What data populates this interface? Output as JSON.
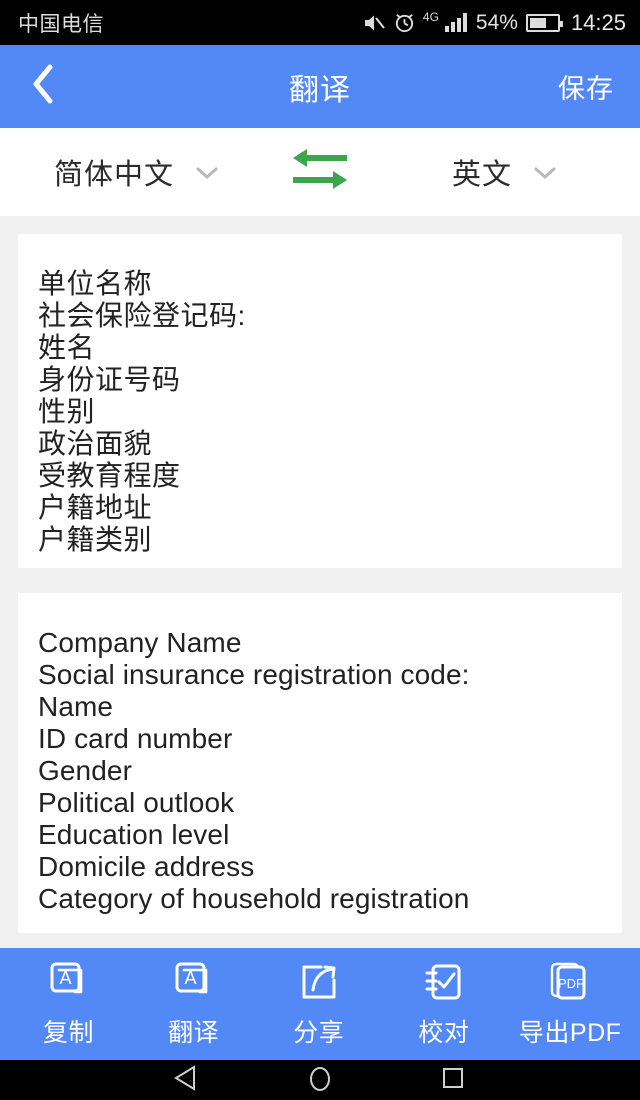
{
  "status_bar": {
    "carrier": "中国电信",
    "mute_icon": "mute-icon",
    "alarm_icon": "alarm-icon",
    "network_type": "4G",
    "signal_icon": "signal-bars-icon",
    "battery_percent": "54%",
    "battery_icon": "battery-icon",
    "time": "14:25"
  },
  "app_bar": {
    "back_icon": "back-chevron-icon",
    "title": "翻译",
    "save_label": "保存",
    "background_color": "#5289f7"
  },
  "language_bar": {
    "source_language": "简体中文",
    "target_language": "英文",
    "source_chevron_icon": "chevron-down-icon",
    "target_chevron_icon": "chevron-down-icon",
    "swap_icon": "swap-arrows-icon",
    "swap_color": "#3ba54b"
  },
  "source_text": {
    "lines": [
      "单位名称",
      "社会保险登记码:",
      "姓名",
      "身份证号码",
      "性别",
      "政治面貌",
      "受教育程度",
      "户籍地址",
      "户籍类别"
    ]
  },
  "target_text": {
    "lines": [
      "Company Name",
      "Social insurance registration code:",
      "Name",
      "ID card number",
      "Gender",
      "Political outlook",
      "Education level",
      "Domicile address",
      "Category of household registration"
    ]
  },
  "toolbar": {
    "items": [
      {
        "label": "复制",
        "icon": "copy-text-icon"
      },
      {
        "label": "翻译",
        "icon": "translate-text-icon"
      },
      {
        "label": "分享",
        "icon": "share-icon"
      },
      {
        "label": "校对",
        "icon": "proofread-check-icon"
      },
      {
        "label": "导出PDF",
        "icon": "export-pdf-icon"
      }
    ]
  },
  "nav_bar": {
    "back_icon": "android-back-icon",
    "home_icon": "android-home-icon",
    "recents_icon": "android-recents-icon"
  }
}
